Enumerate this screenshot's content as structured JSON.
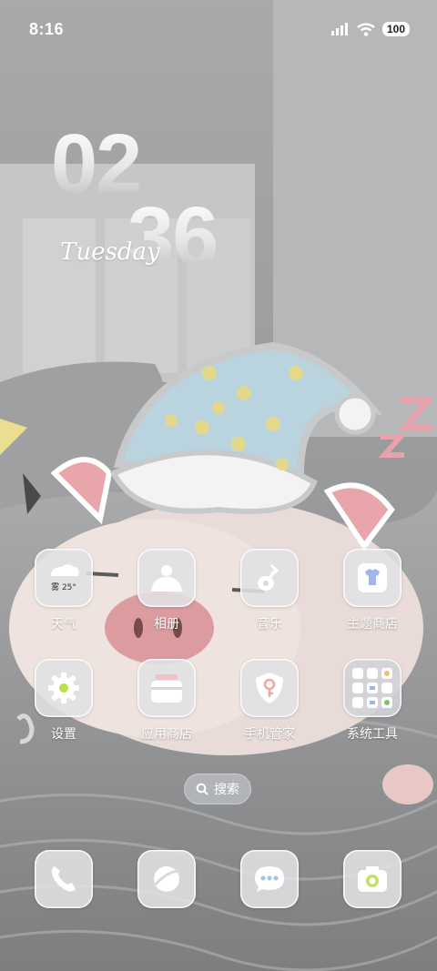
{
  "status_bar": {
    "time": "8:16",
    "battery": "100",
    "icons": [
      "signal-icon",
      "wifi-icon",
      "battery-icon"
    ]
  },
  "clock": {
    "hour": "02",
    "minute": "36",
    "day": "Tuesday"
  },
  "apps": [
    {
      "label": "天气",
      "icon": "weather-icon",
      "badge": "雾 25°"
    },
    {
      "label": "相册",
      "icon": "gallery-icon"
    },
    {
      "label": "音乐",
      "icon": "music-icon"
    },
    {
      "label": "主题商店",
      "icon": "theme-store-icon"
    },
    {
      "label": "设置",
      "icon": "settings-icon"
    },
    {
      "label": "应用商店",
      "icon": "app-store-icon"
    },
    {
      "label": "手机管家",
      "icon": "phone-manager-icon"
    },
    {
      "label": "系统工具",
      "icon": "system-tools-folder-icon"
    }
  ],
  "search": {
    "label": "搜索"
  },
  "dock": [
    {
      "icon": "phone-icon"
    },
    {
      "icon": "browser-icon"
    },
    {
      "icon": "messages-icon"
    },
    {
      "icon": "camera-icon"
    }
  ]
}
